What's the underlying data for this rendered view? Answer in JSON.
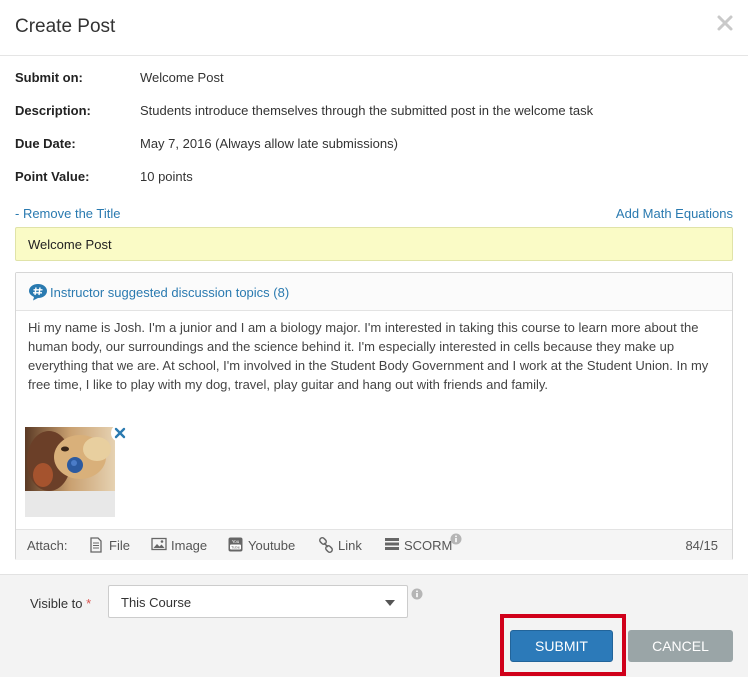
{
  "dialog": {
    "title": "Create Post"
  },
  "assignment": {
    "submit_on_label": "Submit on:",
    "submit_on_value": "Welcome Post",
    "description_label": "Description:",
    "description_value": "Students introduce themselves through the submitted post in the welcome task",
    "due_date_label": "Due Date:",
    "due_date_value": "May 7, 2016 (Always allow late submissions)",
    "point_value_label": "Point Value:",
    "point_value_value": "10 points"
  },
  "links": {
    "remove_title": "- Remove the Title",
    "add_math": "Add Math Equations"
  },
  "post_title": {
    "value": "Welcome Post"
  },
  "editor": {
    "topics_link": "Instructor suggested discussion topics (8)",
    "body": "Hi my name is Josh. I'm a junior and I am a biology major. I'm interested in taking this course to learn more about the human body, our surroundings and the science behind it. I'm especially interested in cells because they make up everything that we are. At school, I'm involved in the Student Body Government and I work at the Student Union. In my free time, I like to play with my dog, travel, play guitar and hang out with friends and family."
  },
  "attach": {
    "label": "Attach:",
    "file": "File",
    "image": "Image",
    "youtube": "Youtube",
    "link": "Link",
    "scorm": "SCORM",
    "char_count": "84/15"
  },
  "footer": {
    "visible_label": "Visible to",
    "required_mark": "*",
    "visible_value": "This Course",
    "submit_label": "SUBMIT",
    "cancel_label": "CANCEL"
  },
  "colors": {
    "link": "#2a7ab0",
    "submit": "#2c7ab9",
    "cancel": "#9aa5a7",
    "highlight": "#d0001a",
    "title_bg": "#fafbc6"
  },
  "icons": {
    "close": "close-icon",
    "topics": "hashtag-speech-bubble-icon",
    "remove_image": "remove-x-icon",
    "file": "file-icon",
    "image": "image-icon",
    "youtube": "youtube-icon",
    "link": "link-icon",
    "scorm": "scorm-icon",
    "info": "info-icon",
    "dropdown": "chevron-down-icon"
  }
}
